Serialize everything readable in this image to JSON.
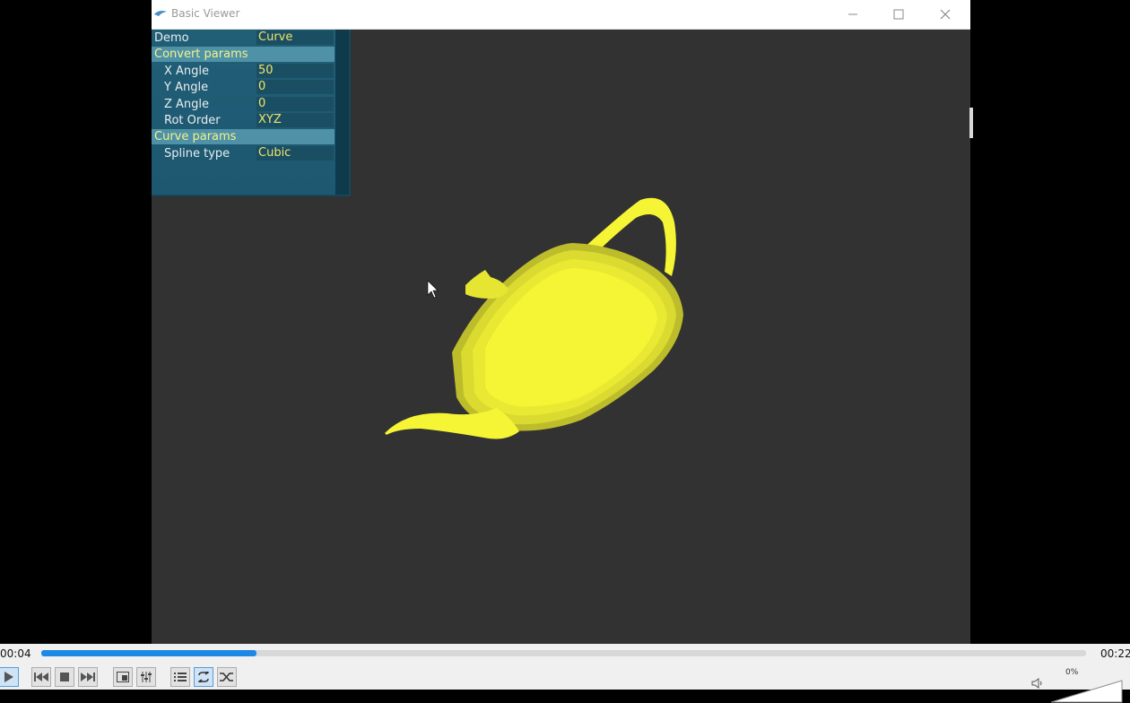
{
  "window": {
    "title": "Basic Viewer",
    "icons": {
      "minimize": "minimize-icon",
      "maximize": "maximize-icon",
      "close": "close-icon"
    }
  },
  "panel": {
    "demo": {
      "label": "Demo",
      "value": "Curve"
    },
    "convert_section": "Convert params",
    "x_angle": {
      "label": "X Angle",
      "value": "50"
    },
    "y_angle": {
      "label": "Y Angle",
      "value": "0"
    },
    "z_angle": {
      "label": "Z Angle",
      "value": "0"
    },
    "rot_order": {
      "label": "Rot Order",
      "value": "XYZ"
    },
    "curve_section": "Curve params",
    "spline_type": {
      "label": "Spline type",
      "value": "Cubic"
    }
  },
  "player": {
    "time_elapsed": "00:04",
    "time_total": "00:22",
    "progress": 0.206,
    "volume_label": "0%",
    "buttons": [
      "play-icon",
      "previous-icon",
      "stop-icon",
      "next-icon",
      "fullscreen-icon",
      "extended-settings-icon",
      "playlist-icon",
      "loop-icon",
      "shuffle-icon"
    ]
  },
  "colors": {
    "teapot": "#f5f535",
    "viewport": "#323232",
    "panel": "#1d5b72",
    "accent": "#1e88e5"
  }
}
